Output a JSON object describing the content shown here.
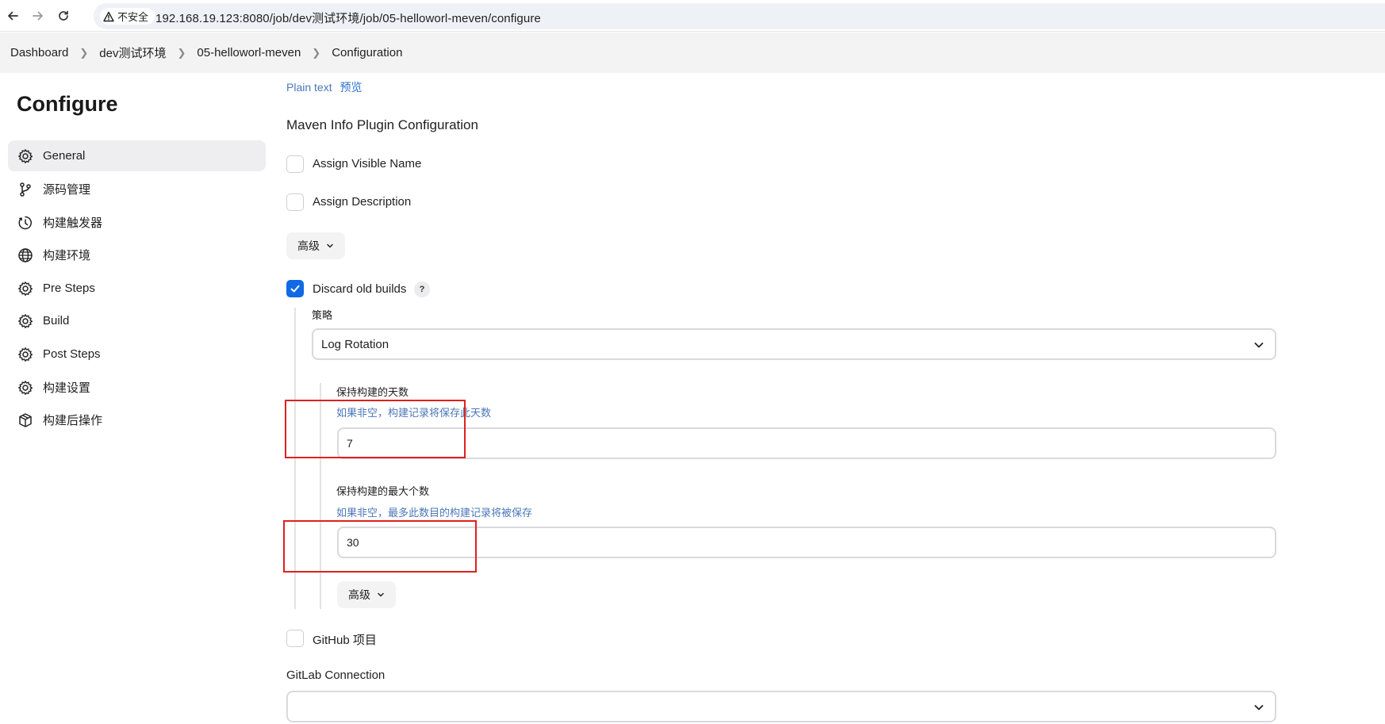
{
  "browser": {
    "security_label": "不安全",
    "url": "192.168.19.123:8080/job/dev测试环境/job/05-helloworl-meven/configure"
  },
  "breadcrumb": [
    "Dashboard",
    "dev测试环境",
    "05-helloworl-meven",
    "Configuration"
  ],
  "sidebar": {
    "title": "Configure",
    "items": [
      {
        "label": "General",
        "icon": "gear-icon",
        "active": true
      },
      {
        "label": "源码管理",
        "icon": "branch-icon"
      },
      {
        "label": "构建触发器",
        "icon": "clock-icon"
      },
      {
        "label": "构建环境",
        "icon": "globe-icon"
      },
      {
        "label": "Pre Steps",
        "icon": "gear-icon"
      },
      {
        "label": "Build",
        "icon": "gear-icon"
      },
      {
        "label": "Post Steps",
        "icon": "gear-icon"
      },
      {
        "label": "构建设置",
        "icon": "gear-icon"
      },
      {
        "label": "构建后操作",
        "icon": "package-icon"
      }
    ]
  },
  "main": {
    "plain_text_label": "Plain text",
    "preview_label": "预览",
    "maven_section_title": "Maven Info Plugin Configuration",
    "assign_visible_name": {
      "label": "Assign Visible Name",
      "checked": false
    },
    "assign_description": {
      "label": "Assign Description",
      "checked": false
    },
    "advanced_label": "高级",
    "discard_old_builds": {
      "label": "Discard old builds",
      "checked": true,
      "help": "?"
    },
    "strategy": {
      "label": "策略",
      "value": "Log Rotation"
    },
    "days_to_keep": {
      "label": "保持构建的天数",
      "description": "如果非空，构建记录将保存此天数",
      "value": "7"
    },
    "max_builds": {
      "label": "保持构建的最大个数",
      "description": "如果非空，最多此数目的构建记录将被保存",
      "value": "30"
    },
    "inner_advanced_label": "高级",
    "github_project": {
      "label": "GitHub 项目",
      "checked": false
    },
    "gitlab_connection": {
      "label": "GitLab Connection",
      "value": ""
    }
  },
  "colors": {
    "accent": "#1169e6",
    "highlight_box": "#e02020",
    "link": "#2f6fd0"
  }
}
